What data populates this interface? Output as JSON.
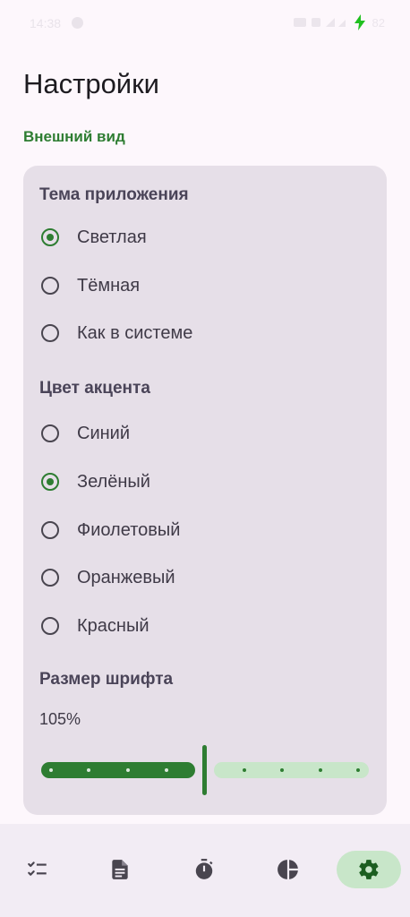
{
  "status_bar": {
    "time": "14:38",
    "battery": "82"
  },
  "page": {
    "title": "Настройки"
  },
  "appearance": {
    "section_title": "Внешний вид",
    "theme": {
      "title": "Тема приложения",
      "options": [
        {
          "label": "Светлая",
          "checked": true
        },
        {
          "label": "Тёмная",
          "checked": false
        },
        {
          "label": "Как в системе",
          "checked": false
        }
      ]
    },
    "accent": {
      "title": "Цвет акцента",
      "options": [
        {
          "label": "Синий",
          "checked": false
        },
        {
          "label": "Зелёный",
          "checked": true
        },
        {
          "label": "Фиолетовый",
          "checked": false
        },
        {
          "label": "Оранжевый",
          "checked": false
        },
        {
          "label": "Красный",
          "checked": false
        }
      ]
    },
    "font_size": {
      "title": "Размер шрифта",
      "value": "105%",
      "slider_fraction": 0.5
    }
  },
  "nav": {
    "items": [
      {
        "icon": "checklist-icon",
        "active": false
      },
      {
        "icon": "document-icon",
        "active": false
      },
      {
        "icon": "timer-icon",
        "active": false
      },
      {
        "icon": "pie-chart-icon",
        "active": false
      },
      {
        "icon": "gear-icon",
        "active": true
      }
    ]
  },
  "colors": {
    "accent": "#2e7d32",
    "accent_container": "#c8e6c9",
    "surface": "#fdf7fc",
    "card": "#e6dfe8"
  }
}
